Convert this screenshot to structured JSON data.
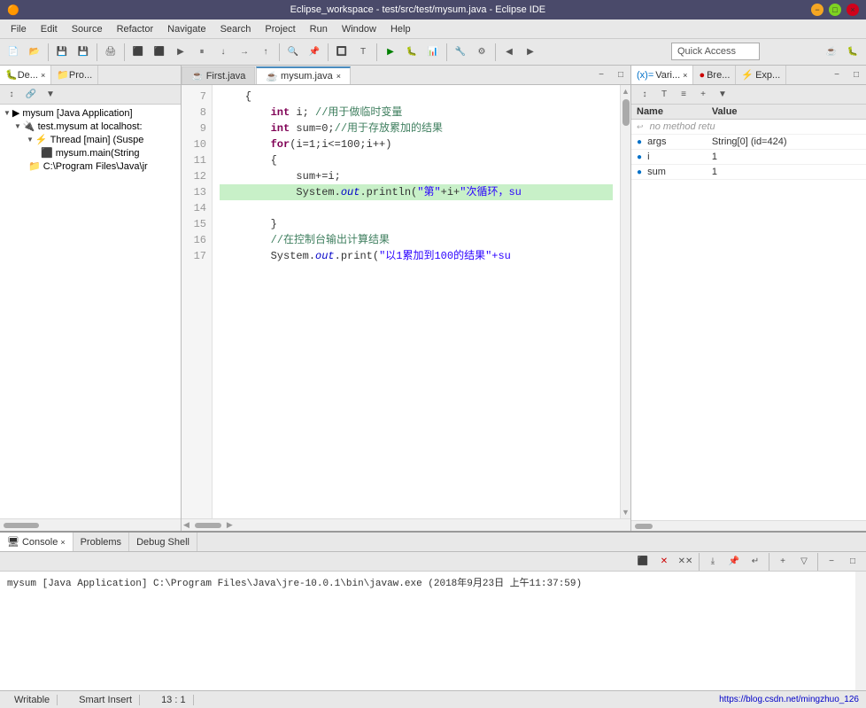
{
  "window": {
    "title": "Eclipse_workspace - test/src/test/mysum.java - Eclipse IDE"
  },
  "menu": {
    "items": [
      "File",
      "Edit",
      "Source",
      "Refactor",
      "Navigate",
      "Search",
      "Project",
      "Run",
      "Window",
      "Help"
    ]
  },
  "toolbar": {
    "quick_access_placeholder": "Quick Access"
  },
  "left_panel": {
    "tabs": [
      {
        "label": "De...",
        "active": false
      },
      {
        "label": "Pro...",
        "active": false
      }
    ],
    "tree": [
      {
        "label": "mysum [Java Application]",
        "indent": 0,
        "arrow": "▼",
        "icon": "▶"
      },
      {
        "label": "test.mysum at localhost:",
        "indent": 1,
        "arrow": "▼",
        "icon": "🔧"
      },
      {
        "label": "Thread [main] (Suspe",
        "indent": 2,
        "arrow": "▼",
        "icon": "⚡"
      },
      {
        "label": "mysum.main(String",
        "indent": 3,
        "arrow": "",
        "icon": "⚡"
      },
      {
        "label": "C:\\Program Files\\Java\\jr",
        "indent": 2,
        "arrow": "",
        "icon": "📁"
      }
    ]
  },
  "editor": {
    "tabs": [
      {
        "label": "First.java",
        "active": false,
        "modified": false
      },
      {
        "label": "mysum.java",
        "active": true,
        "modified": false
      }
    ],
    "lines": [
      {
        "num": 7,
        "code": "    {",
        "highlighted": false
      },
      {
        "num": 8,
        "code": "        int i; //用于做临时变量",
        "highlighted": false
      },
      {
        "num": 9,
        "code": "        int sum=0;//用于存放累加的结果",
        "highlighted": false
      },
      {
        "num": 10,
        "code": "        for(i=1;i<=100;i++)",
        "highlighted": false
      },
      {
        "num": 11,
        "code": "        {",
        "highlighted": false
      },
      {
        "num": 12,
        "code": "            sum+=i;",
        "highlighted": false
      },
      {
        "num": 13,
        "code": "            System.out.println(\"第\"+i+\"次循环，su",
        "highlighted": true,
        "debug": true
      },
      {
        "num": 14,
        "code": "",
        "highlighted": false
      },
      {
        "num": 15,
        "code": "        }",
        "highlighted": false
      },
      {
        "num": 16,
        "code": "        //在控制台输出计算结果",
        "highlighted": false
      },
      {
        "num": 17,
        "code": "        System.out.print(\"以1累加到100的结果\"+su",
        "highlighted": false
      }
    ]
  },
  "variables": {
    "tabs": [
      {
        "label": "Vari...",
        "active": true
      },
      {
        "label": "Bre...",
        "active": false
      },
      {
        "label": "Exp...",
        "active": false
      }
    ],
    "no_method": "no method retu",
    "columns": [
      "Name",
      "Value"
    ],
    "rows": [
      {
        "icon": "●",
        "color": "blue",
        "name": "args",
        "value": "String[0]  (id=424)"
      },
      {
        "icon": "●",
        "color": "blue",
        "name": "i",
        "value": "1"
      },
      {
        "icon": "●",
        "color": "blue",
        "name": "sum",
        "value": "1"
      }
    ]
  },
  "console": {
    "tabs": [
      {
        "label": "Console",
        "active": true
      },
      {
        "label": "Problems",
        "active": false
      },
      {
        "label": "Debug Shell",
        "active": false
      }
    ],
    "output": "mysum [Java Application] C:\\Program Files\\Java\\jre-10.0.1\\bin\\javaw.exe (2018年9月23日 上午11:37:59)"
  },
  "status_bar": {
    "writable": "Writable",
    "insert": "Smart Insert",
    "position": "13 : 1",
    "url": "https://blog.csdn.net/mingzhuo_126"
  }
}
